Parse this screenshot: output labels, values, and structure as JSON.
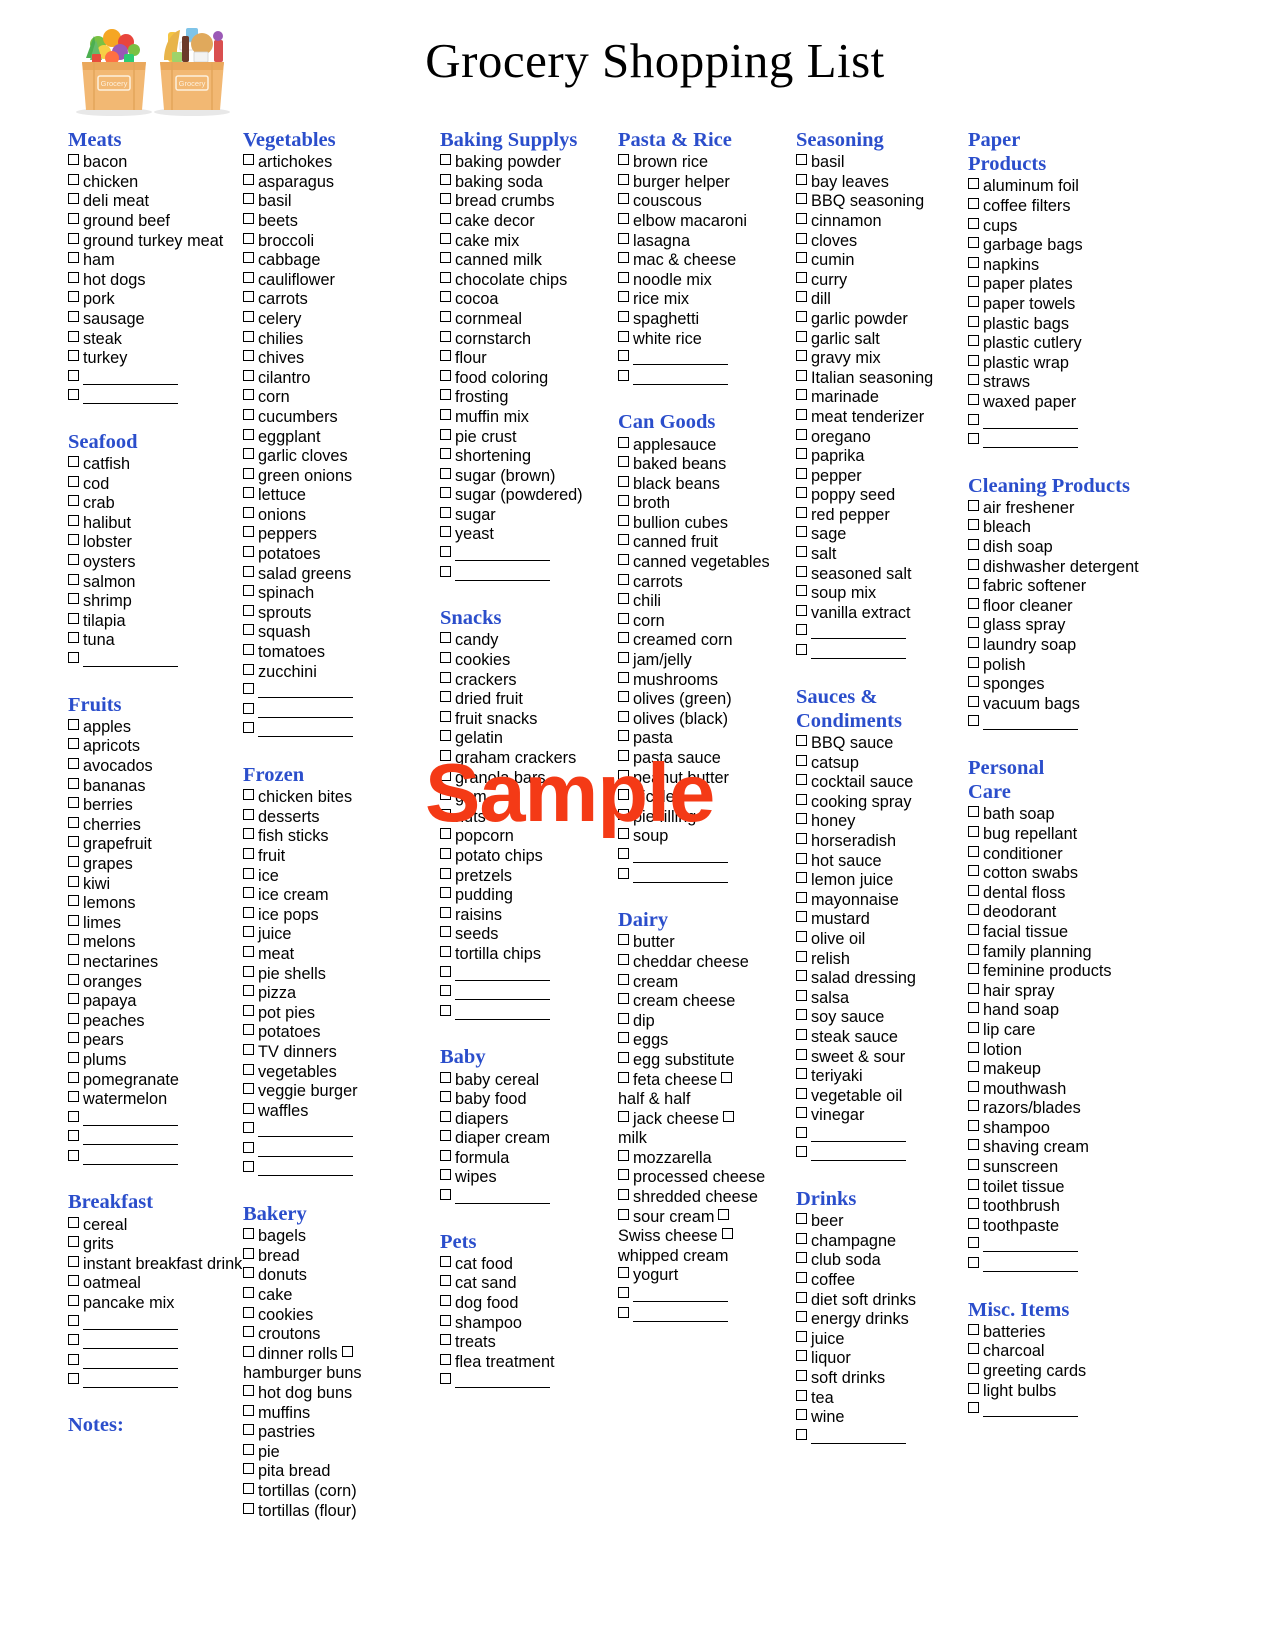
{
  "document": {
    "title": "Grocery Shopping List",
    "watermark": "Sample",
    "notes_label": "Notes:",
    "logo_bag_label": "Grocery",
    "accent_color": "#2b4ecb",
    "watermark_color": "#f43a16"
  },
  "columns": [
    {
      "sections": [
        {
          "heading": "Meats",
          "items": [
            "bacon",
            "chicken",
            "deli meat",
            "ground beef",
            "ground turkey meat",
            "ham",
            "hot dogs",
            "pork",
            "sausage",
            "steak",
            "turkey"
          ],
          "blanks": 2
        },
        {
          "heading": "Seafood",
          "items": [
            "catfish",
            "cod",
            "crab",
            "halibut",
            "lobster",
            "oysters",
            "salmon",
            "shrimp",
            "tilapia",
            "tuna"
          ],
          "blanks": 1
        },
        {
          "heading": "Fruits",
          "items": [
            "apples",
            "apricots",
            "avocados",
            "bananas",
            "berries",
            "cherries",
            "grapefruit",
            "grapes",
            "kiwi",
            "lemons",
            "limes",
            "melons",
            "nectarines",
            "oranges",
            "papaya",
            "peaches",
            "pears",
            "plums",
            "pomegranate",
            "watermelon"
          ],
          "blanks": 3
        },
        {
          "heading": "Breakfast",
          "items": [
            "cereal",
            "grits",
            "instant breakfast drink",
            "oatmeal",
            "pancake mix"
          ],
          "blanks": 4
        }
      ],
      "has_notes": true
    },
    {
      "sections": [
        {
          "heading": "Vegetables",
          "items": [
            "artichokes",
            "asparagus",
            "basil",
            "beets",
            "broccoli",
            "cabbage",
            "cauliflower",
            "carrots",
            "celery",
            "chilies",
            "chives",
            "cilantro",
            "corn",
            "cucumbers",
            "eggplant",
            "garlic cloves",
            "green onions",
            "lettuce",
            "onions",
            "peppers",
            "potatoes",
            "salad greens",
            "spinach",
            "sprouts",
            "squash",
            "tomatoes",
            "zucchini"
          ],
          "blanks": 3
        },
        {
          "heading": "Frozen",
          "items": [
            "chicken bites",
            "desserts",
            "fish sticks",
            "fruit",
            "ice",
            "ice cream",
            "ice pops",
            "juice",
            "meat",
            "pie shells",
            "pizza",
            "pot pies",
            "potatoes",
            "TV dinners",
            "vegetables",
            "veggie burger",
            "waffles"
          ],
          "blanks": 3
        },
        {
          "heading": "Bakery",
          "items": [
            "bagels",
            "bread",
            "donuts",
            "cake",
            "cookies",
            "croutons",
            "dinner rolls",
            "hamburger buns",
            "hot dog buns",
            "muffins",
            "pastries",
            "pie",
            "pita bread",
            "tortillas (corn)",
            "tortillas (flour)"
          ],
          "inline_box_after": [
            "dinner rolls"
          ],
          "no_box": [
            "hamburger buns"
          ],
          "blanks": 0
        }
      ],
      "has_notes": false
    },
    {
      "sections": [
        {
          "heading": "Baking Supplys",
          "items": [
            "baking powder",
            "baking soda",
            "bread crumbs",
            "cake decor",
            "cake mix",
            "canned milk",
            "chocolate chips",
            "cocoa",
            "cornmeal",
            "cornstarch",
            "flour",
            "food coloring",
            "frosting",
            "muffin mix",
            "pie crust",
            "shortening",
            "sugar (brown)",
            "sugar (powdered)",
            "sugar",
            "yeast"
          ],
          "blanks": 2
        },
        {
          "heading": "Snacks",
          "items": [
            "candy",
            "cookies",
            "crackers",
            "dried fruit",
            "fruit snacks",
            "gelatin",
            "graham crackers",
            "granola bars",
            "gum",
            "nuts",
            "popcorn",
            "potato chips",
            "pretzels",
            "pudding",
            "raisins",
            "seeds",
            "tortilla chips"
          ],
          "blanks": 3
        },
        {
          "heading": "Baby",
          "items": [
            "baby cereal",
            "baby food",
            "diapers",
            "diaper cream",
            "formula",
            "wipes"
          ],
          "blanks": 1
        },
        {
          "heading": "Pets",
          "items": [
            "cat food",
            "cat sand",
            "dog food",
            "shampoo",
            "treats",
            "flea treatment"
          ],
          "blanks": 1
        }
      ],
      "has_notes": false
    },
    {
      "sections": [
        {
          "heading": "Pasta & Rice",
          "items": [
            "brown rice",
            "burger helper",
            "couscous",
            "elbow macaroni",
            "lasagna",
            "mac & cheese",
            "noodle mix",
            "rice mix",
            "spaghetti",
            "white rice"
          ],
          "blanks": 2
        },
        {
          "heading": "Can Goods",
          "items": [
            "applesauce",
            "baked beans",
            "black beans",
            "broth",
            "bullion cubes",
            "canned fruit",
            "canned vegetables",
            "carrots",
            "chili",
            "corn",
            "creamed corn",
            "jam/jelly",
            "mushrooms",
            "olives (green)",
            "olives (black)",
            "pasta",
            "pasta sauce",
            "peanut butter",
            "pickles",
            "pie filling",
            "soup"
          ],
          "blanks": 2
        },
        {
          "heading": "Dairy",
          "items": [
            "butter",
            "cheddar cheese",
            "cream",
            "cream cheese",
            "dip",
            "eggs",
            "egg substitute",
            "feta cheese",
            "half & half",
            "jack cheese",
            "milk",
            "mozzarella",
            "processed cheese",
            "shredded cheese",
            "sour cream",
            "Swiss cheese",
            "whipped cream",
            "yogurt"
          ],
          "inline_box_after": [
            "feta cheese",
            "jack cheese",
            "sour cream",
            "Swiss cheese"
          ],
          "no_box": [
            "half & half",
            "milk",
            "Swiss cheese",
            "whipped cream"
          ],
          "blanks": 2
        }
      ],
      "has_notes": false
    },
    {
      "sections": [
        {
          "heading": "Seasoning",
          "items": [
            "basil",
            "bay leaves",
            "BBQ seasoning",
            "cinnamon",
            "cloves",
            "cumin",
            "curry",
            "dill",
            "garlic powder",
            "garlic salt",
            "gravy mix",
            "Italian seasoning",
            "marinade",
            "meat tenderizer",
            "oregano",
            "paprika",
            "pepper",
            "poppy seed",
            "red pepper",
            "sage",
            "salt",
            "seasoned salt",
            "soup mix",
            "vanilla extract"
          ],
          "blanks": 2
        },
        {
          "heading": "Sauces &\nCondiments",
          "items": [
            "BBQ sauce",
            "catsup",
            "cocktail sauce",
            "cooking spray",
            "honey",
            "horseradish",
            "hot sauce",
            "lemon juice",
            "mayonnaise",
            "mustard",
            "olive oil",
            "relish",
            "salad dressing",
            "salsa",
            "soy sauce",
            "steak sauce",
            "sweet & sour",
            "teriyaki",
            "vegetable oil",
            "vinegar"
          ],
          "blanks": 2
        },
        {
          "heading": "Drinks",
          "items": [
            "beer",
            "champagne",
            "club soda",
            "coffee",
            "diet soft drinks",
            "energy drinks",
            "juice",
            "liquor",
            "soft drinks",
            "tea",
            "wine"
          ],
          "blanks": 1
        }
      ],
      "has_notes": false
    },
    {
      "sections": [
        {
          "heading": "Paper\nProducts",
          "items": [
            "aluminum foil",
            "coffee filters",
            "cups",
            "garbage bags",
            "napkins",
            "paper plates",
            "paper towels",
            "plastic bags",
            "plastic cutlery",
            "plastic wrap",
            "straws",
            "waxed paper"
          ],
          "blanks": 2
        },
        {
          "heading": "Cleaning  Products",
          "items": [
            "air freshener",
            "bleach",
            "dish soap",
            "dishwasher detergent",
            "fabric softener",
            "floor cleaner",
            "glass spray",
            "laundry soap",
            "polish",
            "sponges",
            "vacuum bags"
          ],
          "blanks": 1
        },
        {
          "heading": "Personal\nCare",
          "items": [
            "bath soap",
            "bug repellant",
            "conditioner",
            "cotton swabs",
            "dental floss",
            "deodorant",
            "facial tissue",
            "family planning",
            "feminine products",
            "hair spray",
            "hand soap",
            "lip care",
            "lotion",
            "makeup",
            "mouthwash",
            "razors/blades",
            "shampoo",
            "shaving cream",
            "sunscreen",
            "toilet tissue",
            "toothbrush",
            "toothpaste"
          ],
          "blanks": 2
        },
        {
          "heading": "Misc. Items",
          "items": [
            "batteries",
            "charcoal",
            "greeting cards",
            "light bulbs"
          ],
          "blanks": 1
        }
      ],
      "has_notes": false
    }
  ]
}
